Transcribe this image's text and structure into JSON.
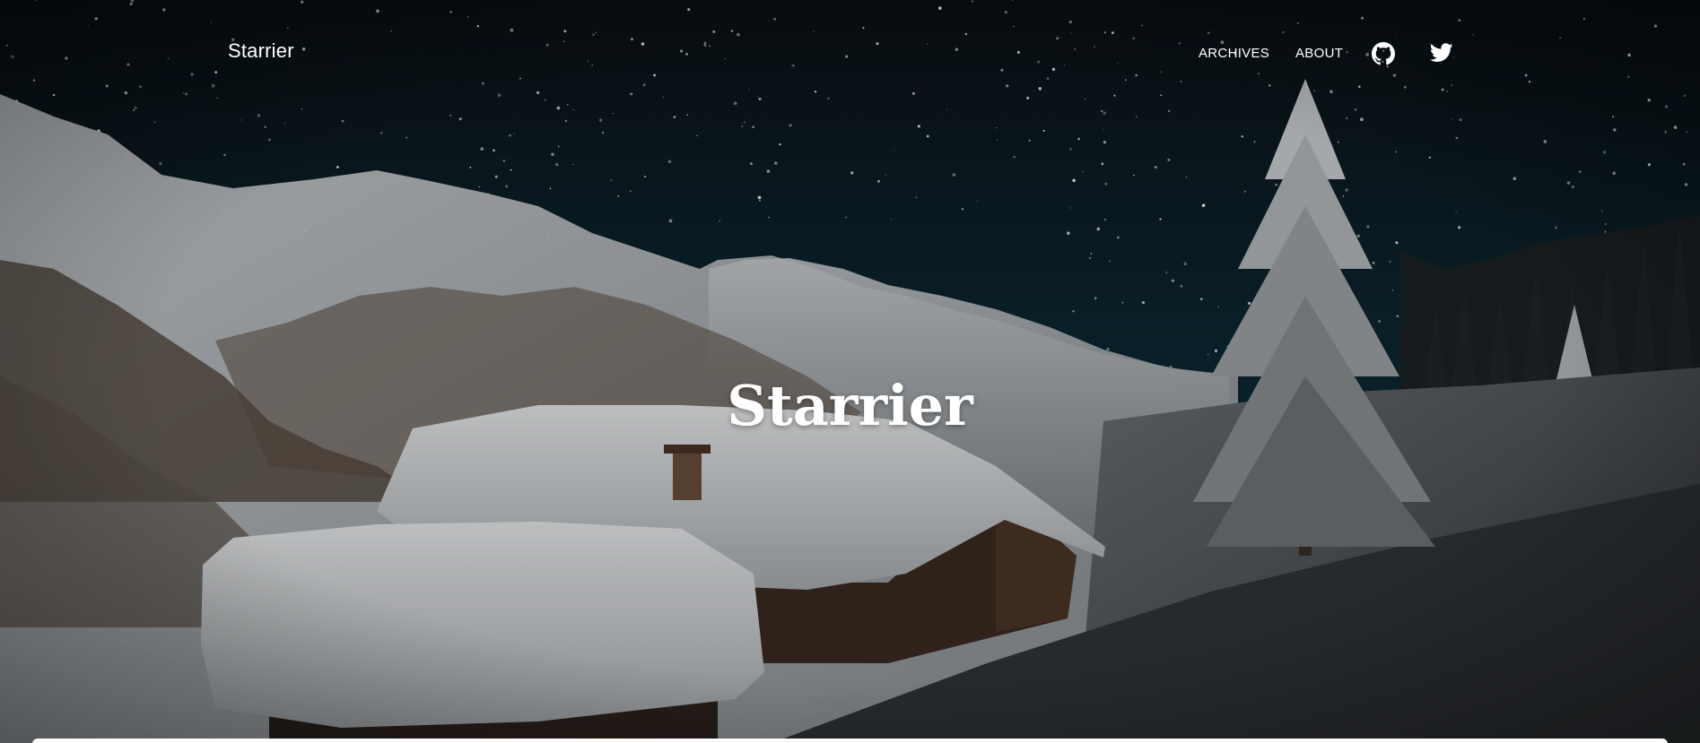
{
  "site": {
    "brand": "Starrier"
  },
  "nav": {
    "items": [
      {
        "label": "ARCHIVES"
      },
      {
        "label": "ABOUT"
      }
    ],
    "icons": [
      "github-icon",
      "twitter-icon"
    ]
  },
  "hero": {
    "title": "Starrier",
    "background": "night-sky-snowy-mountains-cabin"
  },
  "colors": {
    "sky_top": "#0a0f14",
    "sky_mid": "#0c2a33",
    "snow": "#d9dde0",
    "text": "#ffffff"
  }
}
